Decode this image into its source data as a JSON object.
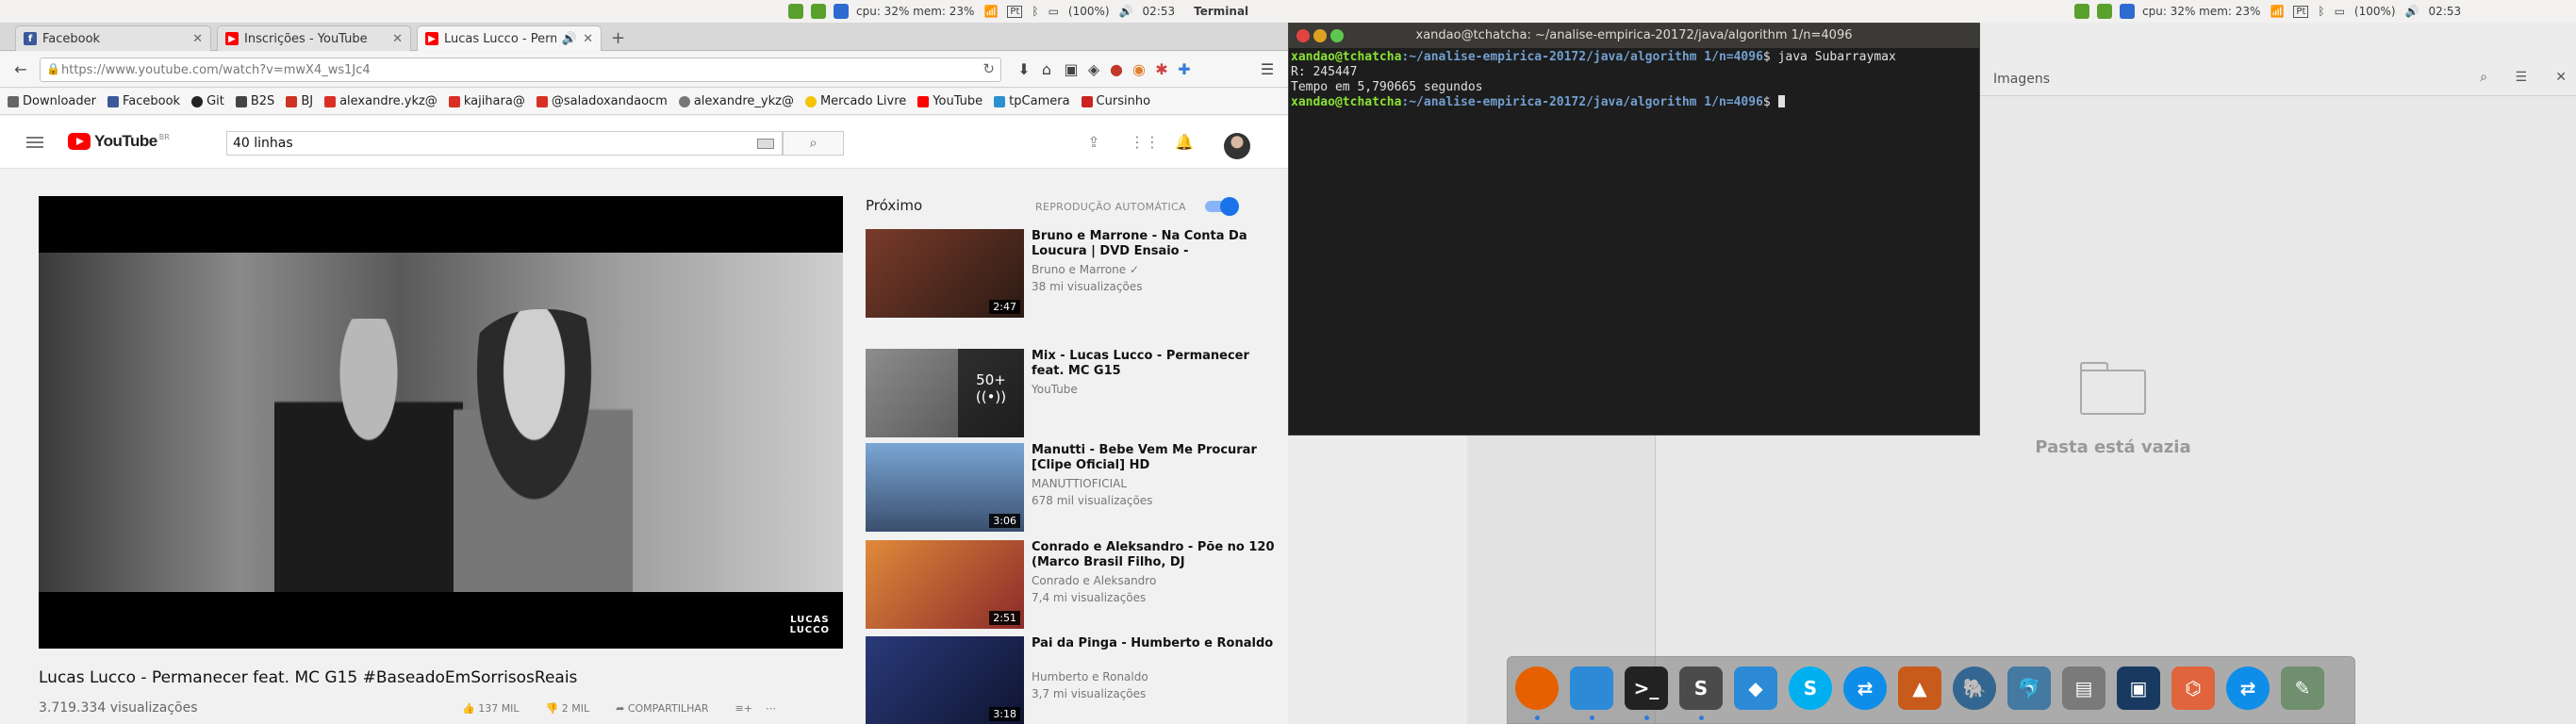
{
  "left_panel": {
    "cpu": "cpu: 32% mem: 23%",
    "battery": "(100%)",
    "time": "02:53",
    "app": "Terminal",
    "sig": "Pt"
  },
  "tabs": [
    {
      "label": "Facebook",
      "color": "#3b5998",
      "letter": "f"
    },
    {
      "label": "Inscrições - YouTube",
      "color": "#ff0000",
      "letter": "▶"
    },
    {
      "label": "Lucas Lucco - Perma",
      "color": "#ff0000",
      "letter": "▶"
    }
  ],
  "url": "https://www.youtube.com/watch?v=mwX4_ws1Jc4",
  "bookmarks": [
    {
      "label": "Downloader",
      "color": "#666666"
    },
    {
      "label": "Facebook",
      "color": "#3b5998"
    },
    {
      "label": "Git",
      "color": "#222222"
    },
    {
      "label": "B2S",
      "color": "#444444"
    },
    {
      "label": "BJ",
      "color": "#cc3322"
    },
    {
      "label": "alexandre.ykz@",
      "color": "#d93025"
    },
    {
      "label": "kajihara@",
      "color": "#d93025"
    },
    {
      "label": "@saladoxandaocm",
      "color": "#d93025"
    },
    {
      "label": "alexandre_ykz@",
      "color": "#777777"
    },
    {
      "label": "Mercado Livre",
      "color": "#f5c400"
    },
    {
      "label": "YouTube",
      "color": "#ff0000"
    },
    {
      "label": "tpCamera",
      "color": "#2c8fd0"
    },
    {
      "label": "Cursinho",
      "color": "#cc2222"
    }
  ],
  "youtube": {
    "logo": "YouTube",
    "region": "BR",
    "search_value": "40 linhas",
    "video_title": "Lucas Lucco - Permanecer feat. MC G15 #BaseadoEmSorrisosReais",
    "views": "3.719.334 visualizações",
    "likes": "137 MIL",
    "dislikes": "2 MIL",
    "share": "COMPARTILHAR",
    "watermark_line1": "LUCAS",
    "watermark_line2": "LUCCO",
    "up_next": "Próximo",
    "autoplay": "REPRODUÇÃO AUTOMÁTICA",
    "autoplay_on": true,
    "recommendations": [
      {
        "title": "Bruno e Marrone - Na Conta Da Loucura | DVD Ensaio -",
        "channel": "Bruno e Marrone ✓",
        "views": "38 mi visualizações",
        "duration": "2:47",
        "thumb": "#7a3b2a"
      },
      {
        "title": "Mix - Lucas Lucco - Permanecer feat. MC G15",
        "channel": "YouTube",
        "views": "",
        "duration": "",
        "mix_count": "50+",
        "thumb": "#6a6a6a"
      },
      {
        "title": "Manutti - Bebe Vem Me Procurar [Clipe Oficial] HD",
        "channel": "MANUTTIOFICIAL",
        "views": "678 mil visualizações",
        "duration": "3:06",
        "thumb": "#4c6f94"
      },
      {
        "title": "Conrado e Aleksandro - Põe no 120 (Marco Brasil Filho, DJ",
        "channel": "Conrado e Aleksandro",
        "views": "7,4 mi visualizações",
        "duration": "2:51",
        "thumb": "#b84e2a"
      },
      {
        "title": "Pai da Pinga - Humberto e Ronaldo",
        "channel": "Humberto e Ronaldo",
        "views": "3,7 mi visualizações",
        "duration": "3:18",
        "thumb": "#1f2a52"
      }
    ]
  },
  "right_panel": {
    "cpu": "cpu: 32% mem: 23%",
    "battery": "(100%)",
    "time": "02:53",
    "sig": "Pt"
  },
  "terminal": {
    "title": "xandao@tchatcha: ~/analise-empirica-20172/java/algorithm 1/n=4096",
    "user": "xandao@tchatcha",
    "path": ":~/analise-empirica-20172/java/algorithm 1/n=4096",
    "prompt_end": "$ ",
    "command": "java Subarraymax",
    "out1": "R: 245447",
    "out2": "Tempo em 5,790665 segundos"
  },
  "files": {
    "title": "Imagens",
    "empty": "Pasta está vazia"
  },
  "dock": [
    {
      "name": "firefox",
      "color": "#e66000"
    },
    {
      "name": "finder",
      "color": "#2d8ad6"
    },
    {
      "name": "terminal",
      "color": "#222222"
    },
    {
      "name": "sublime",
      "color": "#4b4b4b"
    },
    {
      "name": "dropbox",
      "color": "#2d8ad6"
    },
    {
      "name": "skype",
      "color": "#00aff0"
    },
    {
      "name": "teamviewer",
      "color": "#0e8ee9"
    },
    {
      "name": "matlab",
      "color": "#c85a1b"
    },
    {
      "name": "postgres",
      "color": "#336791"
    },
    {
      "name": "mysql",
      "color": "#4479a1"
    },
    {
      "name": "system",
      "color": "#7a7a7a"
    },
    {
      "name": "virtualbox",
      "color": "#183a61"
    },
    {
      "name": "network",
      "color": "#e0643c"
    },
    {
      "name": "teamviewer2",
      "color": "#0e8ee9"
    },
    {
      "name": "editor",
      "color": "#6f8f6f"
    }
  ]
}
